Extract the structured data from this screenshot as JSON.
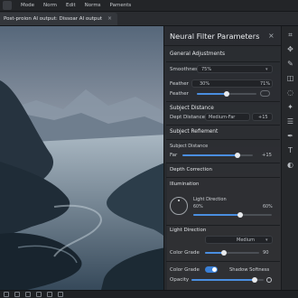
{
  "menubar": {
    "items": [
      "Mode",
      "Norm",
      "Edit",
      "Norms",
      "Paments"
    ]
  },
  "tab": {
    "label": "Post-proion AI output: Dissoar AI output",
    "close": "×"
  },
  "panel": {
    "title": "Neural Filter Parameters",
    "close": "×",
    "general": {
      "heading": "General Adjustments",
      "smoothness_label": "Smoothness",
      "smoothness_value": "75%",
      "feather_label": "Feather",
      "feather_left": "30%",
      "feather_right": "71%",
      "feather2_label": "Feather",
      "feather2_level": 0.5
    },
    "subject_distance": {
      "heading": "Subject Distance",
      "depth_label": "Dept Distance",
      "depth_value": "Medium-Far",
      "depth_number": "+15"
    },
    "subject_refinement": {
      "heading": "Subject Refiement",
      "distance_label": "Subject Distance",
      "far_label": "Far",
      "far_value": "+15",
      "far_level": 0.78
    },
    "depth_correction": {
      "heading": "Depth Correction"
    },
    "illumination": {
      "heading": "Illumination",
      "light_direction_label": "Light Direction",
      "left_pct": "60%",
      "right_pct": "60%",
      "level": 0.6
    },
    "light_direction": {
      "heading": "Light Direction",
      "value": "Medium"
    },
    "color_grade": {
      "label": "Color Grade",
      "value": "90",
      "level": 0.35
    },
    "bottom": {
      "color_grade_label": "Color Grade",
      "shadow_label": "Shadow Softness",
      "opacity_label": "Opacity",
      "opacity_level": 0.88
    }
  },
  "toolbar": {
    "icons": [
      "crop-icon",
      "move-icon",
      "brush-icon",
      "eraser-icon",
      "lasso-icon",
      "magic-wand-icon",
      "layers-icon",
      "pen-icon",
      "text-icon",
      "adjust-icon"
    ]
  },
  "colors": {
    "accent": "#4a8ee0",
    "panel": "#282a2e",
    "sky_top": "#5d6e7f",
    "sky_horizon": "#e6c7b2"
  }
}
